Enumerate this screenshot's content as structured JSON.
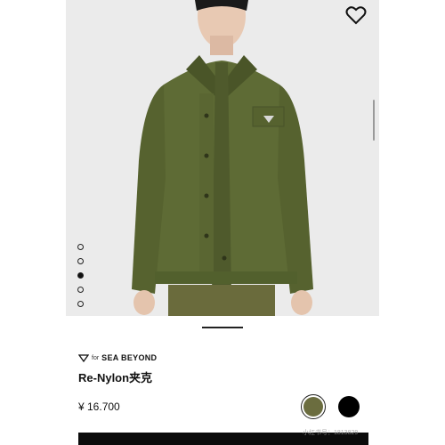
{
  "product": {
    "brand_prefix": "for",
    "brand_name": "SEA BEYOND",
    "title": "Re-Nylon夹克",
    "price": "¥ 16.700",
    "colors": {
      "selected": "#6b6d3f",
      "other": "#000000"
    }
  },
  "gallery": {
    "image_count": 5,
    "active_index": 2
  },
  "watermark": "小红书号：1813829"
}
